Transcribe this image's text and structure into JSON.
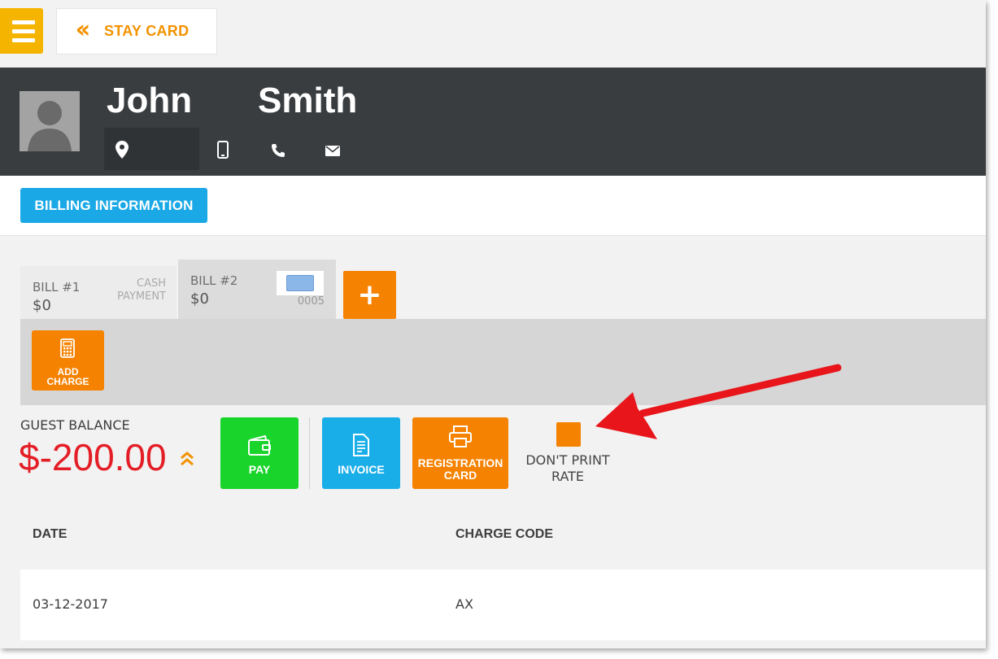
{
  "topbar": {
    "menu_icon": "hamburger-menu-icon",
    "back_icon": "double-chevron-left-icon",
    "back_label": "STAY CARD"
  },
  "guest": {
    "first_name": "John",
    "last_name": "Smith",
    "icons": [
      "location-pin-icon",
      "mobile-phone-icon",
      "phone-icon",
      "envelope-icon"
    ]
  },
  "billing": {
    "button_label": "BILLING INFORMATION"
  },
  "bills": [
    {
      "name": "BILL #1",
      "amount": "$0",
      "payment_line1": "CASH",
      "payment_line2": "PAYMENT"
    },
    {
      "name": "BILL #2",
      "amount": "$0",
      "card_number": "0005"
    }
  ],
  "add_bill_label": "+",
  "add_charge": {
    "line1": "ADD",
    "line2": "CHARGE",
    "icon": "calculator-icon"
  },
  "balance": {
    "title": "GUEST BALANCE",
    "amount": "$-200.00"
  },
  "actions": {
    "pay": "PAY",
    "invoice": "INVOICE",
    "registration_line1": "REGISTRATION",
    "registration_line2": "CARD"
  },
  "dont_print": {
    "line1": "DON'T PRINT",
    "line2": "RATE"
  },
  "table": {
    "headers": [
      "DATE",
      "CHARGE CODE"
    ],
    "rows": [
      {
        "date": "03-12-2017",
        "charge_code": "AX"
      }
    ]
  },
  "colors": {
    "accent_orange": "#f58200",
    "menu_yellow": "#f5b400",
    "header_dark": "#3a3d40",
    "billing_blue": "#1aa8e6",
    "pay_green": "#19d42a",
    "balance_red": "#e41e26",
    "annotation_red": "#e8161b"
  }
}
